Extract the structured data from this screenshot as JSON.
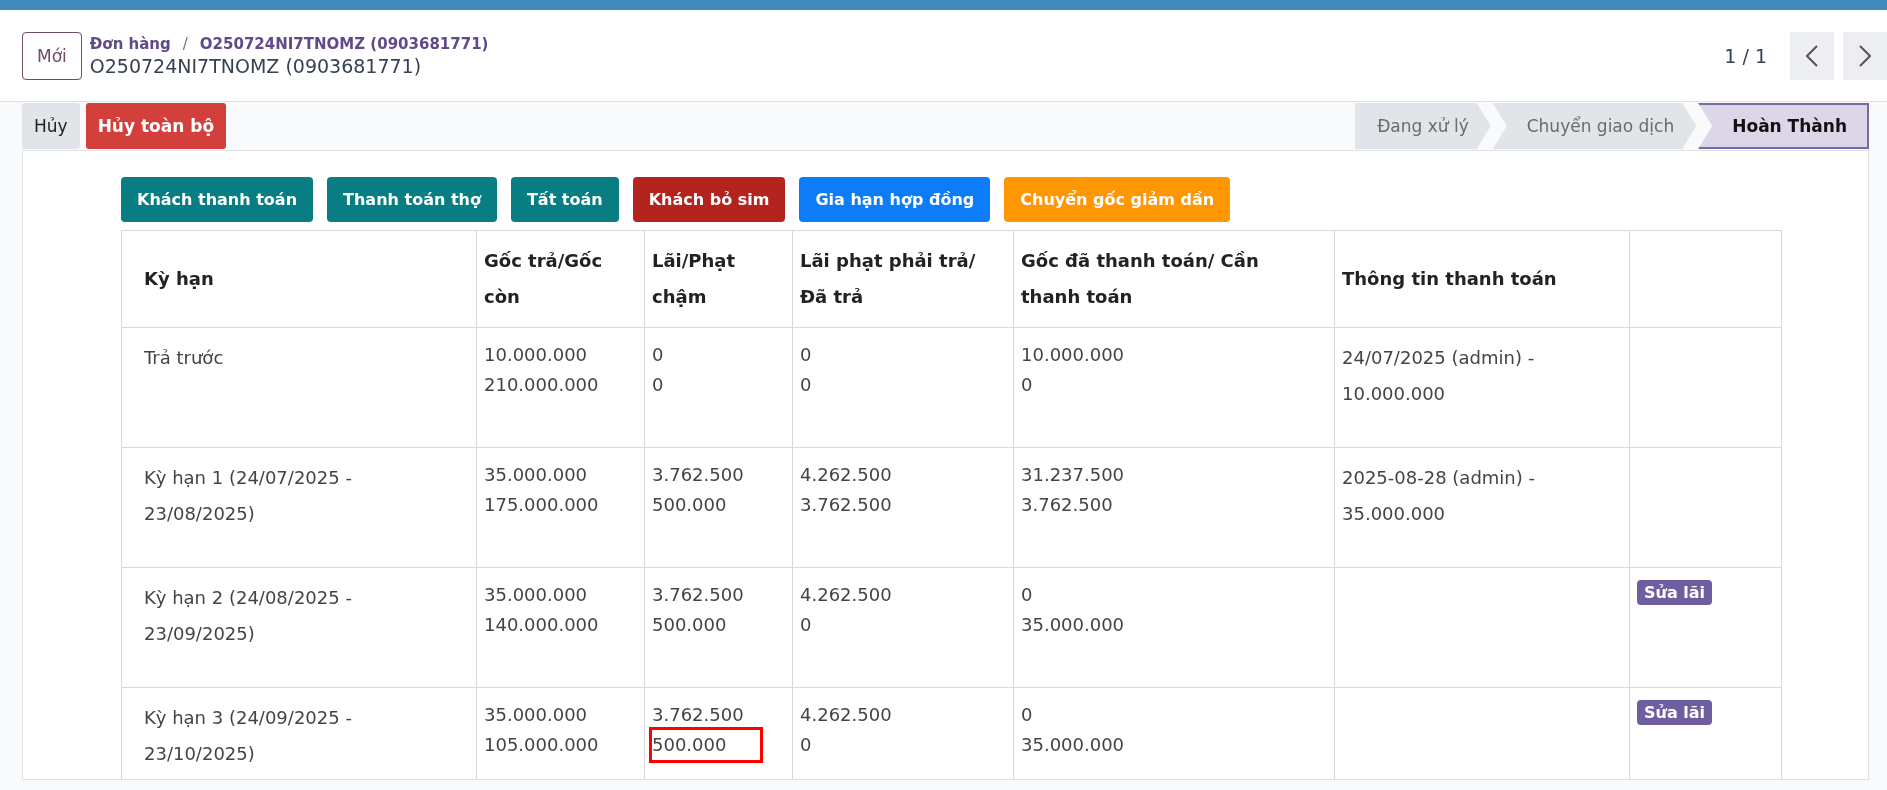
{
  "header": {
    "new_button": "Mới",
    "breadcrumb": {
      "parent": "Đơn hàng",
      "separator": "/",
      "current": "O250724NI7TNOMZ (0903681771)"
    },
    "title": "O250724NI7TNOMZ (0903681771)",
    "pager": "1 / 1"
  },
  "actions": [
    {
      "label": "Hủy",
      "kind": "secondary"
    },
    {
      "label": "Hủy toàn bộ",
      "kind": "danger"
    }
  ],
  "stages": [
    {
      "label": "Đang xử lý",
      "selected": false
    },
    {
      "label": "Chuyển giao dịch",
      "selected": false
    },
    {
      "label": "Hoàn Thành",
      "selected": true
    }
  ],
  "payment_buttons": [
    {
      "label": "Khách thanh toán",
      "color": "#087d82"
    },
    {
      "label": "Thanh toán thợ",
      "color": "#087d82"
    },
    {
      "label": "Tất toán",
      "color": "#087d82"
    },
    {
      "label": "Khách bỏ sim",
      "color": "#b3241e"
    },
    {
      "label": "Gia hạn hợp đồng",
      "color": "#0d7cf7"
    },
    {
      "label": "Chuyển gốc giảm dần",
      "color": "#ff9705"
    }
  ],
  "table": {
    "columns": [
      "Kỳ hạn",
      "Gốc trả/Gốc còn",
      "Lãi/Phạt chậm",
      "Lãi phạt phải trả/ Đã trả",
      "Gốc đã thanh toán/ Cần thanh toán",
      "Thông tin thanh toán",
      ""
    ],
    "rows": [
      {
        "cells": [
          {
            "kind": "text",
            "text": "Trả trước"
          },
          {
            "kind": "lines",
            "lines": [
              "10.000.000",
              "210.000.000"
            ],
            "boxed": [
              false,
              false
            ]
          },
          {
            "kind": "lines",
            "lines": [
              "0",
              "0"
            ],
            "boxed": [
              false,
              false
            ]
          },
          {
            "kind": "lines",
            "lines": [
              "0",
              "0"
            ],
            "boxed": [
              false,
              false
            ]
          },
          {
            "kind": "lines",
            "lines": [
              "10.000.000",
              "0"
            ],
            "boxed": [
              false,
              false
            ]
          },
          {
            "kind": "text",
            "text": "24/07/2025 (admin) - 10.000.000"
          },
          {
            "kind": "empty"
          }
        ]
      },
      {
        "cells": [
          {
            "kind": "text",
            "text": "Kỳ hạn 1 (24/07/2025 - 23/08/2025)"
          },
          {
            "kind": "lines",
            "lines": [
              "35.000.000",
              "175.000.000"
            ],
            "boxed": [
              false,
              false
            ]
          },
          {
            "kind": "lines",
            "lines": [
              "3.762.500",
              "500.000"
            ],
            "boxed": [
              false,
              false
            ]
          },
          {
            "kind": "lines",
            "lines": [
              "4.262.500",
              "3.762.500"
            ],
            "boxed": [
              false,
              false
            ]
          },
          {
            "kind": "lines",
            "lines": [
              "31.237.500",
              "3.762.500"
            ],
            "boxed": [
              false,
              false
            ]
          },
          {
            "kind": "text",
            "text": "2025-08-28 (admin) - 35.000.000"
          },
          {
            "kind": "empty"
          }
        ]
      },
      {
        "cells": [
          {
            "kind": "text",
            "text": "Kỳ hạn 2 (24/08/2025 - 23/09/2025)"
          },
          {
            "kind": "lines",
            "lines": [
              "35.000.000",
              "140.000.000"
            ],
            "boxed": [
              false,
              false
            ]
          },
          {
            "kind": "lines",
            "lines": [
              "3.762.500",
              "500.000"
            ],
            "boxed": [
              false,
              false
            ]
          },
          {
            "kind": "lines",
            "lines": [
              "4.262.500",
              "0"
            ],
            "boxed": [
              false,
              false
            ]
          },
          {
            "kind": "lines",
            "lines": [
              "0",
              "35.000.000"
            ],
            "boxed": [
              false,
              false
            ]
          },
          {
            "kind": "empty"
          },
          {
            "kind": "button",
            "text": "Sửa lãi"
          }
        ]
      },
      {
        "cells": [
          {
            "kind": "text",
            "text": "Kỳ hạn 3 (24/09/2025 - 23/10/2025)"
          },
          {
            "kind": "lines",
            "lines": [
              "35.000.000",
              "105.000.000"
            ],
            "boxed": [
              false,
              false
            ]
          },
          {
            "kind": "lines",
            "lines": [
              "3.762.500",
              "500.000"
            ],
            "boxed": [
              false,
              true
            ]
          },
          {
            "kind": "lines",
            "lines": [
              "4.262.500",
              "0"
            ],
            "boxed": [
              false,
              false
            ]
          },
          {
            "kind": "lines",
            "lines": [
              "0",
              "35.000.000"
            ],
            "boxed": [
              false,
              false
            ]
          },
          {
            "kind": "empty"
          },
          {
            "kind": "button",
            "text": "Sửa lãi"
          }
        ]
      }
    ]
  }
}
